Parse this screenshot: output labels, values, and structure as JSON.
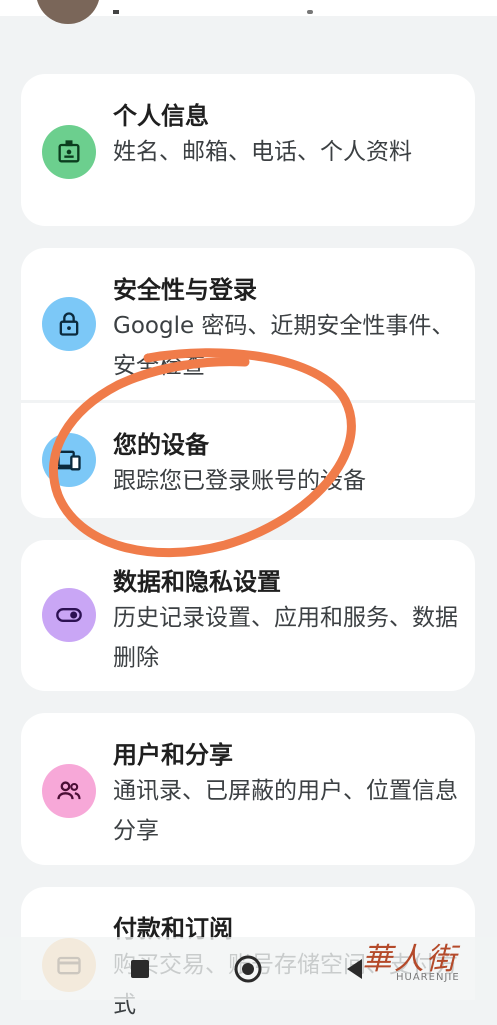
{
  "sections": [
    {
      "title": "个人信息",
      "desc": "姓名、邮箱、电话、个人资料",
      "icon": "id-badge-icon",
      "color": "#6ccf8e"
    },
    {
      "title": "安全性与登录",
      "desc": "Google 密码、近期安全性事件、安全检查",
      "icon": "lock-icon",
      "color": "#7cc8f7"
    },
    {
      "title": "您的设备",
      "desc": "跟踪您已登录账号的设备",
      "icon": "devices-icon",
      "color": "#7cc8f7"
    },
    {
      "title": "数据和隐私设置",
      "desc": "历史记录设置、应用和服务、数据删除",
      "icon": "toggle-icon",
      "color": "#c9a6f5"
    },
    {
      "title": "用户和分享",
      "desc": "通讯录、已屏蔽的用户、位置信息分享",
      "icon": "people-icon",
      "color": "#f7a8d8"
    },
    {
      "title": "付款和订阅",
      "desc": "购买交易、账号存储空间、支付方式",
      "icon": "card-icon",
      "color": "#f8c98b"
    }
  ],
  "watermark": {
    "text": "華人街",
    "sub": "HUARENJIE"
  },
  "annotation_color": "#f07c4a"
}
